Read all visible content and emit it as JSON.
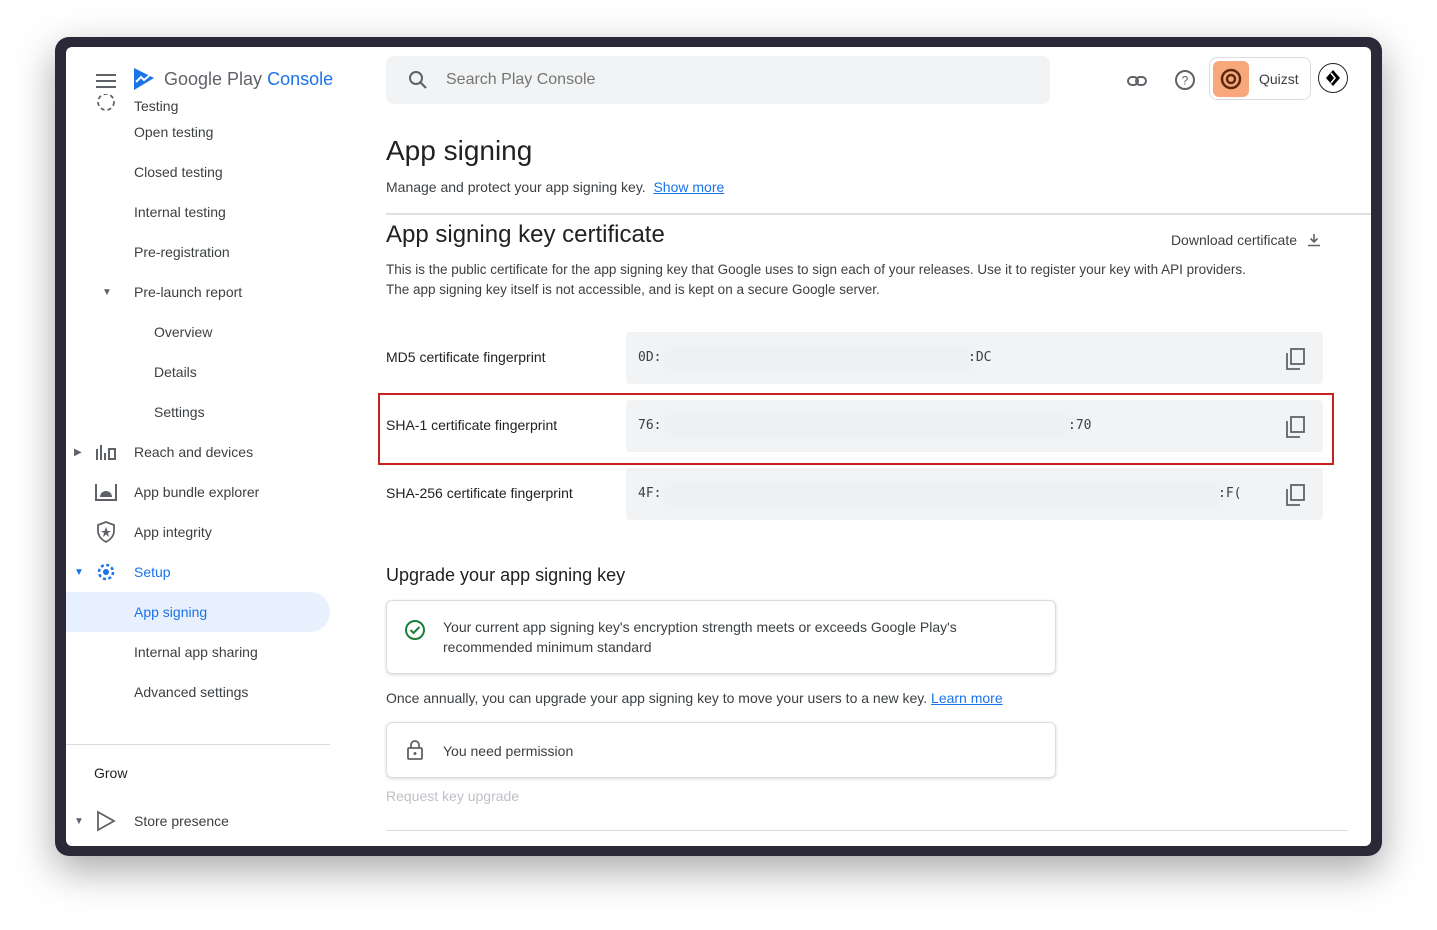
{
  "app": {
    "brand": "Google Play",
    "brand_suffix": "Console"
  },
  "search": {
    "placeholder": "Search Play Console"
  },
  "account": {
    "name": "Quizst"
  },
  "colors": {
    "accent": "#1a73e8",
    "highlight": "#c5221f",
    "avatar": "#f8a77a",
    "success": "#188038"
  },
  "sidebar": {
    "items": [
      {
        "label": "Testing",
        "level": 1,
        "icon": "testing-icon",
        "partial": true
      },
      {
        "label": "Open testing",
        "level": 1
      },
      {
        "label": "Closed testing",
        "level": 1
      },
      {
        "label": "Internal testing",
        "level": 1
      },
      {
        "label": "Pre-registration",
        "level": 1
      },
      {
        "label": "Pre-launch report",
        "level": 1,
        "expanded": true
      },
      {
        "label": "Overview",
        "level": 2
      },
      {
        "label": "Details",
        "level": 2
      },
      {
        "label": "Settings",
        "level": 2
      },
      {
        "label": "Reach and devices",
        "level": 0,
        "icon": "bar-chart-icon",
        "collapsed": true
      },
      {
        "label": "App bundle explorer",
        "level": 0,
        "icon": "android-icon"
      },
      {
        "label": "App integrity",
        "level": 0,
        "icon": "shield-icon"
      },
      {
        "label": "Setup",
        "level": 0,
        "icon": "gear-icon",
        "expanded": true
      },
      {
        "label": "App signing",
        "level": 1,
        "active": true
      },
      {
        "label": "Internal app sharing",
        "level": 1
      },
      {
        "label": "Advanced settings",
        "level": 1
      }
    ],
    "section": "Grow",
    "grow_items": [
      {
        "label": "Store presence",
        "icon": "play-icon",
        "expanded": true
      }
    ]
  },
  "page": {
    "title": "App signing",
    "description": "Manage and protect your app signing key.",
    "show_more": "Show more",
    "cert": {
      "title": "App signing key certificate",
      "download": "Download certificate",
      "description": "This is the public certificate for the app signing key that Google uses to sign each of your releases. Use it to register your key with API providers. The app signing key itself is not accessible, and is kept on a secure Google server.",
      "fingerprints": [
        {
          "label": "MD5 certificate fingerprint",
          "start": "0D:",
          "end": ":DC"
        },
        {
          "label": "SHA-1 certificate fingerprint",
          "start": "76:",
          "end": ":70",
          "highlighted": true
        },
        {
          "label": "SHA-256 certificate fingerprint",
          "start": "4F:",
          "end": ":F("
        }
      ]
    },
    "upgrade": {
      "title": "Upgrade your app signing key",
      "status": "Your current app signing key's encryption strength meets or exceeds Google Play's recommended minimum standard",
      "info": "Once annually, you can upgrade your app signing key to move your users to a new key.",
      "learn_more": "Learn more",
      "permission": "You need permission",
      "request": "Request key upgrade"
    }
  }
}
